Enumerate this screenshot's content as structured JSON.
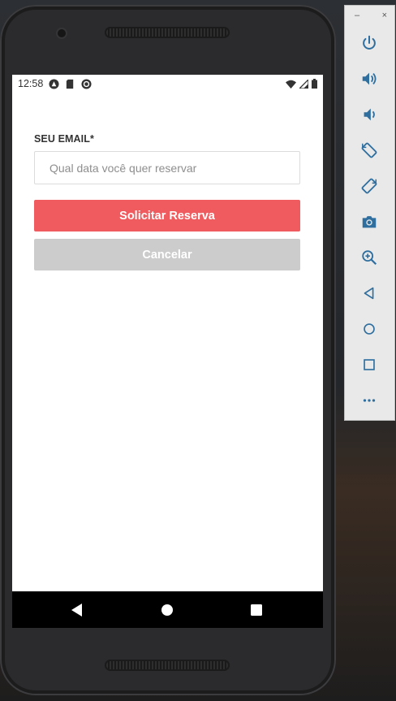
{
  "status_bar": {
    "time": "12:58",
    "left_icons": [
      "notification-circle-icon",
      "sd-card-icon",
      "sync-circle-icon"
    ],
    "right_icons": [
      "wifi-icon",
      "signal-icon",
      "battery-icon"
    ]
  },
  "form": {
    "email_label": "SEU EMAIL*",
    "input_value": "",
    "input_placeholder": "Qual data você quer reservar",
    "submit_label": "Solicitar Reserva",
    "cancel_label": "Cancelar"
  },
  "nav_bar": {
    "buttons": [
      "back-icon",
      "home-icon",
      "recents-icon"
    ]
  },
  "emulator_panel": {
    "minimize": "–",
    "close": "×",
    "buttons": [
      "power-icon",
      "volume-up-icon",
      "volume-down-icon",
      "rotate-left-icon",
      "rotate-right-icon",
      "camera-icon",
      "zoom-icon",
      "back-icon",
      "home-icon",
      "overview-icon",
      "more-icon"
    ]
  },
  "colors": {
    "primary_button": "#ef5b5e",
    "secondary_button": "#cccccc",
    "panel_icon": "#2f6f9f"
  }
}
